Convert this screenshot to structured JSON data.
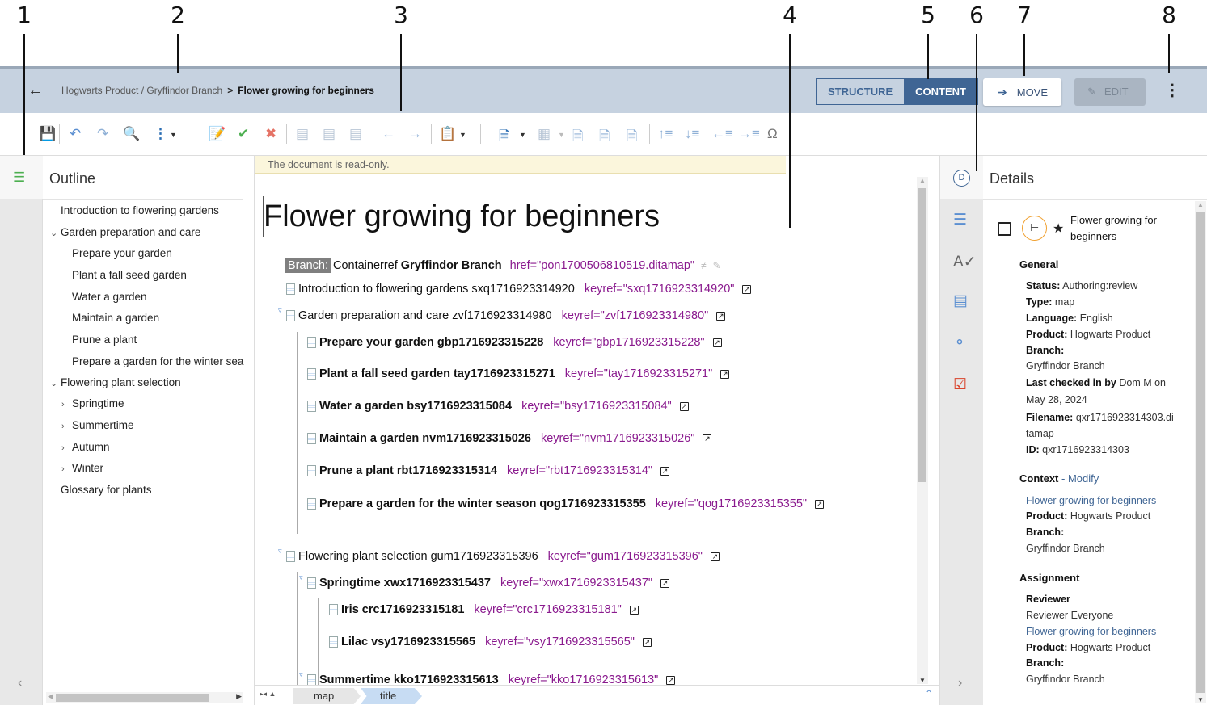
{
  "callouts": [
    "1",
    "2",
    "3",
    "4",
    "5",
    "6",
    "7",
    "8"
  ],
  "header": {
    "back_icon": "arrow-left-icon",
    "breadcrumb_path": "Hogwarts Product / Gryffindor Branch",
    "breadcrumb_sep": ">",
    "breadcrumb_current": "Flower growing for beginners",
    "view_toggle": {
      "structure": "STRUCTURE",
      "content": "CONTENT",
      "active": "CONTENT"
    },
    "move_label": "MOVE",
    "edit_label": "EDIT",
    "accent": "#3f6594"
  },
  "toolbar": {
    "icons": [
      "save",
      "undo",
      "redo",
      "find",
      "more",
      "accept-reject",
      "accept",
      "reject",
      "insert-comment",
      "edit-comment",
      "remove-comment",
      "previous-change",
      "next-change",
      "paste",
      "map-view",
      "insert-table",
      "new-topic",
      "insert-reference",
      "insert-keyref",
      "move-up",
      "move-down",
      "promote",
      "demote",
      "special-character"
    ]
  },
  "outline": {
    "title": "Outline",
    "items": [
      {
        "label": "Introduction to flowering gardens",
        "level": 0,
        "chevron": ""
      },
      {
        "label": "Garden preparation and care",
        "level": 0,
        "chevron": "expanded"
      },
      {
        "label": "Prepare your garden",
        "level": 1,
        "chevron": ""
      },
      {
        "label": "Plant a fall seed garden",
        "level": 1,
        "chevron": ""
      },
      {
        "label": "Water a garden",
        "level": 1,
        "chevron": ""
      },
      {
        "label": "Maintain a garden",
        "level": 1,
        "chevron": ""
      },
      {
        "label": "Prune a plant",
        "level": 1,
        "chevron": ""
      },
      {
        "label": "Prepare a garden for the winter sea",
        "level": 1,
        "chevron": ""
      },
      {
        "label": "Flowering plant selection",
        "level": 0,
        "chevron": "expanded"
      },
      {
        "label": "Springtime",
        "level": 1,
        "chevron": "collapsed"
      },
      {
        "label": "Summertime",
        "level": 1,
        "chevron": "collapsed"
      },
      {
        "label": "Autumn",
        "level": 1,
        "chevron": "collapsed"
      },
      {
        "label": "Winter",
        "level": 1,
        "chevron": "collapsed"
      },
      {
        "label": "Glossary for plants",
        "level": 0,
        "chevron": ""
      }
    ]
  },
  "editor": {
    "readonly_notice": "The document is read-only.",
    "title": "Flower growing for beginners",
    "branch": {
      "tag": "Branch:",
      "prefix": "Containerref",
      "name": "Gryffindor Branch",
      "href": "href=\"pon1700506810519.ditamap\""
    },
    "rows": [
      {
        "text": "Introduction to flowering gardens sxq1716923314920",
        "keyref": "keyref=\"sxq1716923314920\"",
        "bold": false,
        "expander": false
      },
      {
        "text": "Garden preparation and care zvf1716923314980",
        "keyref": "keyref=\"zvf1716923314980\"",
        "bold": false,
        "expander": true
      },
      {
        "text": "Prepare your garden gbp1716923315228",
        "keyref": "keyref=\"gbp1716923315228\"",
        "bold": true,
        "expander": false
      },
      {
        "text": "Plant a fall seed garden tay1716923315271",
        "keyref": "keyref=\"tay1716923315271\"",
        "bold": true,
        "expander": false
      },
      {
        "text": "Water a garden bsy1716923315084",
        "keyref": "keyref=\"bsy1716923315084\"",
        "bold": true,
        "expander": false
      },
      {
        "text": "Maintain a garden nvm1716923315026",
        "keyref": "keyref=\"nvm1716923315026\"",
        "bold": true,
        "expander": false
      },
      {
        "text": "Prune a plant rbt1716923315314",
        "keyref": "keyref=\"rbt1716923315314\"",
        "bold": true,
        "expander": false
      },
      {
        "text": "Prepare a garden for the winter season qog1716923315355",
        "keyref": "keyref=\"qog1716923315355\"",
        "bold": true,
        "expander": false
      },
      {
        "text": "Flowering plant selection gum1716923315396",
        "keyref": "keyref=\"gum1716923315396\"",
        "bold": false,
        "expander": true
      },
      {
        "text": "Springtime xwx1716923315437",
        "keyref": "keyref=\"xwx1716923315437\"",
        "bold": true,
        "expander": true
      },
      {
        "text": "Iris crc1716923315181",
        "keyref": "keyref=\"crc1716923315181\"",
        "bold": true,
        "expander": false
      },
      {
        "text": "Lilac vsy1716923315565",
        "keyref": "keyref=\"vsy1716923315565\"",
        "bold": true,
        "expander": false
      },
      {
        "text": "Summertime kko1716923315613",
        "keyref": "keyref=\"kko1716923315613\"",
        "bold": true,
        "expander": true
      }
    ],
    "breadcrumbs": [
      "map",
      "title"
    ],
    "keyref_color": "#8a1a8e"
  },
  "details": {
    "title": "Details",
    "item_name": "Flower growing for beginners",
    "general_heading": "General",
    "general": [
      {
        "label": "Status:",
        "value": "Authoring:review"
      },
      {
        "label": "Type:",
        "value": "map"
      },
      {
        "label": "Language:",
        "value": "English"
      },
      {
        "label": "Product:",
        "value": "Hogwarts Product"
      },
      {
        "label": "Branch:",
        "value": ""
      },
      {
        "label": "",
        "value": "Gryffindor Branch"
      },
      {
        "label": "Last checked in by",
        "value": "Dom M on"
      },
      {
        "label": "",
        "value": "May 28, 2024"
      },
      {
        "label": "Filename:",
        "value": "qxr1716923314303.di"
      },
      {
        "label": "",
        "value": "tamap"
      },
      {
        "label": "ID:",
        "value": "qxr1716923314303"
      }
    ],
    "context_heading": "Context",
    "context_modify": "- Modify",
    "context_link": "Flower growing for beginners",
    "context": [
      {
        "label": "Product:",
        "value": "Hogwarts Product"
      },
      {
        "label": "Branch:",
        "value": ""
      },
      {
        "label": "",
        "value": "Gryffindor Branch"
      }
    ],
    "assignment_heading": "Assignment",
    "assignment_role": "Reviewer",
    "assignment_person": "Reviewer Everyone",
    "assignment_link": "Flower growing for beginners",
    "assignment": [
      {
        "label": "Product:",
        "value": "Hogwarts Product"
      },
      {
        "label": "Branch:",
        "value": ""
      },
      {
        "label": "",
        "value": "Gryffindor Branch"
      }
    ]
  },
  "right_rail": {
    "icons": [
      "details-icon",
      "map-structure-icon",
      "spellcheck-icon",
      "comments-icon",
      "tags-icon",
      "checked-in-icon"
    ]
  }
}
